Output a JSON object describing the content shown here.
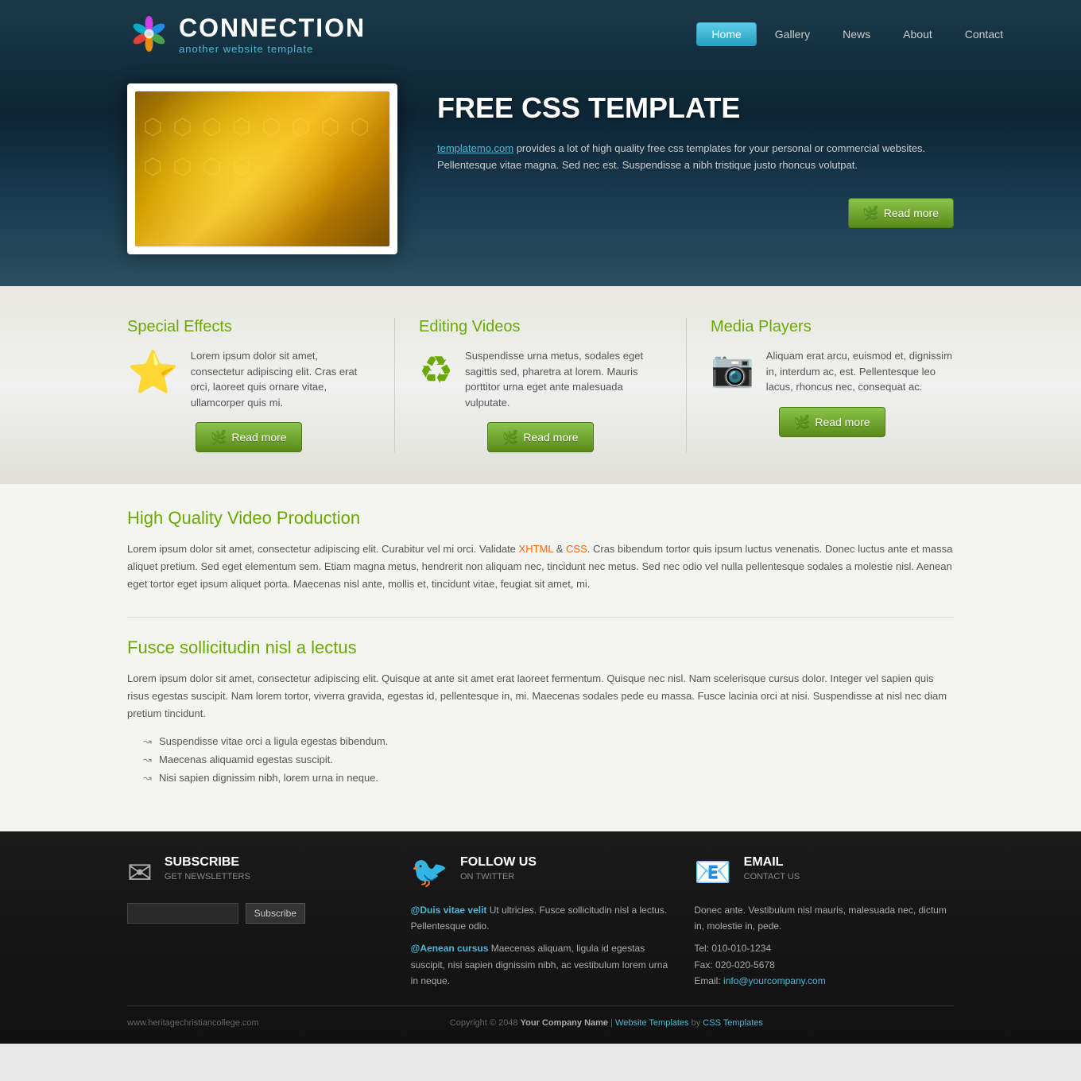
{
  "logo": {
    "title": "CONNECTION",
    "subtitle": "another website template"
  },
  "nav": {
    "items": [
      {
        "label": "Home",
        "active": true
      },
      {
        "label": "Gallery",
        "active": false
      },
      {
        "label": "News",
        "active": false
      },
      {
        "label": "About",
        "active": false
      },
      {
        "label": "Contact",
        "active": false
      }
    ]
  },
  "hero": {
    "title": "FREE CSS TEMPLATE",
    "link_text": "templatemo.com",
    "body": " provides a lot of high quality free css templates for your personal or commercial websites. Pellentesque vitae magna. Sed nec est. Suspendisse a nibh tristique justo rhoncus volutpat.",
    "read_more": "Read more"
  },
  "features": {
    "items": [
      {
        "title": "Special Effects",
        "text": "Lorem ipsum dolor sit amet, consectetur adipiscing elit. Cras erat orci, laoreet quis ornare vitae, ullamcorper quis mi.",
        "read_more": "Read more"
      },
      {
        "title": "Editing Videos",
        "text": "Suspendisse urna metus, sodales eget sagittis sed, pharetra at lorem. Mauris porttitor urna eget ante malesuada vulputate.",
        "read_more": "Read more"
      },
      {
        "title": "Media Players",
        "text": "Aliquam erat arcu, euismod et, dignissim in, interdum ac, est. Pellentesque leo lacus, rhoncus nec, consequat ac.",
        "read_more": "Read more"
      }
    ]
  },
  "content": {
    "section1": {
      "title": "High Quality Video Production",
      "text": "Lorem ipsum dolor sit amet, consectetur adipiscing elit. Curabitur vel mi orci. Validate ",
      "link1_text": "XHTML",
      "middle_text": " & ",
      "link2_text": "CSS",
      "end_text": ". Cras bibendum tortor quis ipsum luctus venenatis. Donec luctus ante et massa aliquet pretium. Sed eget elementum sem. Etiam magna metus, hendrerit non aliquam nec, tincidunt nec metus. Sed nec odio vel nulla pellentesque sodales a molestie nisl. Aenean eget tortor eget ipsum aliquet porta. Maecenas nisl ante, mollis et, tincidunt vitae, feugiat sit amet, mi."
    },
    "section2": {
      "title": "Fusce sollicitudin nisl a lectus",
      "text": "Lorem ipsum dolor sit amet, consectetur adipiscing elit. Quisque at ante sit amet erat laoreet fermentum. Quisque nec nisl. Nam scelerisque cursus dolor. Integer vel sapien quis risus egestas suscipit. Nam lorem tortor, viverra gravida, egestas id, pellentesque in, mi. Maecenas sodales pede eu massa. Fusce lacinia orci at nisi. Suspendisse at nisl nec diam pretium tincidunt.",
      "bullets": [
        "Suspendisse vitae orci a ligula egestas bibendum.",
        "Maecenas aliquamid egestas suscipit.",
        "Nisi sapien dignissim nibh, lorem urna in neque."
      ]
    }
  },
  "footer": {
    "subscribe": {
      "title": "SUBSCRIBE",
      "subtitle": "GET NEWSLETTERS",
      "input_placeholder": "",
      "button_label": "Subscribe"
    },
    "follow": {
      "title": "FOLLOW US",
      "subtitle": "ON TWITTER",
      "link1_text": "@Duis vitae velit",
      "link1_body": " Ut ultricies. Fusce sollicitudin nisl a lectus. Pellentesque odio.",
      "link2_text": "@Aenean cursus",
      "link2_body": " Maecenas aliquam, ligula id egestas suscipit, nisi sapien dignissim nibh, ac vestibulum lorem urna in neque."
    },
    "email": {
      "title": "EMAIL",
      "subtitle": "CONTACT US",
      "contact_text": "Donec ante. Vestibulum nisl mauris, malesuada nec, dictum in, molestie in, pede.",
      "tel": "Tel: 010-010-1234",
      "fax": "Fax: 020-020-5678",
      "email_label": "Email: ",
      "email_link_text": "info@yourcompany.com"
    },
    "bottom": {
      "website": "www.heritagechristiancollege.com",
      "copyright": "Copyright © 2048 ",
      "company": "Your Company Name",
      "sep1": " | ",
      "link_text": "Website Templates",
      "by": " by ",
      "css_link": "CSS Templates"
    }
  }
}
